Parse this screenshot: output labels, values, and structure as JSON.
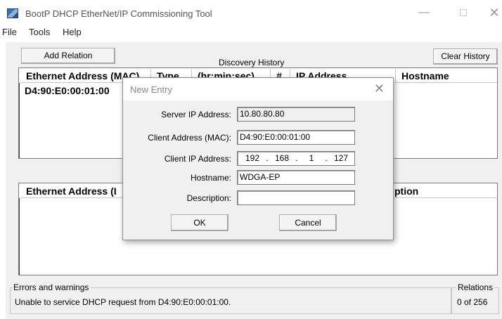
{
  "window": {
    "title": "BootP DHCP EtherNet/IP Commissioning Tool",
    "icons": {
      "app": "bootp-app-icon",
      "minimize": "minimize-icon",
      "maximize": "maximize-icon",
      "close": "close-icon"
    },
    "minimize_glyph": "—",
    "close_glyph": "✕"
  },
  "menu": {
    "items": [
      "File",
      "Tools",
      "Help"
    ]
  },
  "toolbar": {
    "add_relation": "Add Relation",
    "clear_history": "Clear History"
  },
  "discovery": {
    "label": "Discovery History",
    "columns": [
      "Ethernet Address (MAC)",
      "Type",
      "(hr:min:sec)",
      "#",
      "IP Address",
      "Hostname"
    ],
    "rows": [
      {
        "mac": "D4:90:E0:00:01:00"
      }
    ]
  },
  "relations_list": {
    "columns": [
      "Ethernet Address (MAC)",
      "Description"
    ],
    "columns_visible": [
      "Ethernet Address (I",
      "ption"
    ]
  },
  "status": {
    "errors_label": "Errors and warnings",
    "error_message": "Unable to service DHCP request from D4:90:E0:00:01:00.",
    "relations_label": "Relations",
    "relations_count": "0 of 256"
  },
  "dialog": {
    "title": "New Entry",
    "close_glyph": "✕",
    "fields": {
      "server_ip": {
        "label": "Server IP Address:",
        "value": "10.80.80.80"
      },
      "client_mac": {
        "label": "Client Address (MAC):",
        "value": "D4:90:E0:00:01:00"
      },
      "client_ip": {
        "label": "Client IP Address:",
        "octets": [
          "192",
          "168",
          "1",
          "127"
        ]
      },
      "hostname": {
        "label": "Hostname:",
        "value": "WDGA-EP"
      },
      "description": {
        "label": "Description:",
        "value": ""
      }
    },
    "ok": "OK",
    "cancel": "Cancel"
  }
}
